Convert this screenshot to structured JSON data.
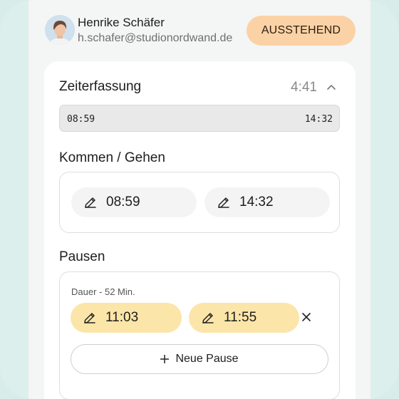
{
  "user": {
    "name": "Henrike Schäfer",
    "email": "h.schafer@studionordwand.de"
  },
  "status_badge": "AUSSTEHEND",
  "time_tracking": {
    "title": "Zeiterfassung",
    "total": "4:41",
    "timeline_start": "08:59",
    "timeline_end": "14:32"
  },
  "check_in_out": {
    "title": "Kommen / Gehen",
    "start": "08:59",
    "end": "14:32"
  },
  "breaks": {
    "title": "Pausen",
    "duration_label": "Dauer - 52 Min.",
    "start": "11:03",
    "end": "11:55",
    "new_break_label": "Neue Pause"
  },
  "colors": {
    "status_badge": "#fbd2a6",
    "break_pill": "#fce5a8",
    "background": "#dcefed"
  },
  "icons": [
    "pencil-icon",
    "close-icon",
    "plus-icon",
    "chevron-up-icon"
  ]
}
